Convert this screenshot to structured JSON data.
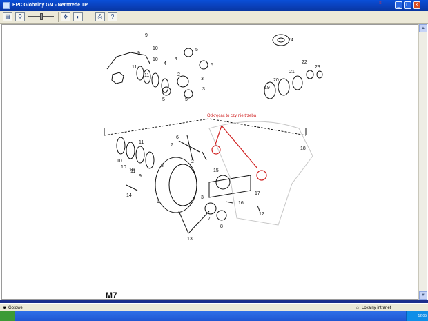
{
  "window": {
    "title": "EPC Globalny GM - Nemtrede TP",
    "corner_mark": "≡"
  },
  "toolbar": {
    "buttons": [
      {
        "name": "save",
        "glyph": "▤"
      },
      {
        "name": "zoom",
        "glyph": "⚲"
      },
      {
        "name": "fit",
        "glyph": "✥"
      },
      {
        "name": "contrast",
        "glyph": "◐"
      },
      {
        "name": "print",
        "glyph": "⎙"
      },
      {
        "name": "help",
        "glyph": "?"
      }
    ]
  },
  "diagram": {
    "annotation": "Odkręcać to czy nie trzeba",
    "page_code": "M7",
    "callouts": [
      "9",
      "10",
      "11",
      "4",
      "5",
      "5",
      "3",
      "2",
      "3",
      "5",
      "5",
      "10",
      "11",
      "24",
      "22",
      "21",
      "23",
      "20",
      "19",
      "6",
      "11",
      "10",
      "9",
      "7",
      "18",
      "2",
      "15",
      "14",
      "1",
      "3",
      "16",
      "17",
      "7",
      "8",
      "12",
      "13",
      "10",
      "11",
      "8",
      "4",
      "9",
      "10"
    ]
  },
  "statusbar": {
    "left": "Gotowe",
    "zone": "Lokalny intranet"
  },
  "taskbar": {
    "clock": "12:05"
  },
  "colors": {
    "titlebar": "#0a3fb8",
    "annotation": "#d02020",
    "chrome": "#ece9d8"
  }
}
